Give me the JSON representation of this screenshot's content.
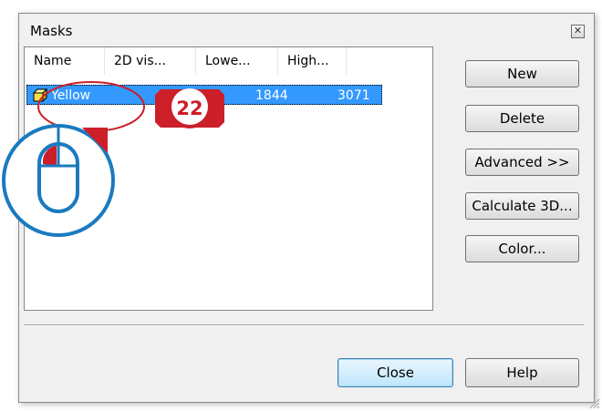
{
  "window": {
    "title": "Masks",
    "close_icon": "close-icon"
  },
  "list": {
    "columns": [
      "Name",
      "2D vis...",
      "Lowe...",
      "High..."
    ],
    "rows": [
      {
        "name": "Yellow",
        "lower": "1844",
        "higher": "3071",
        "icon": "yellow-cube-icon",
        "selected": true
      }
    ]
  },
  "buttons": {
    "new": "New",
    "delete": "Delete",
    "advanced": "Advanced >>",
    "calculate3d": "Calculate 3D...",
    "color": "Color...",
    "close": "Close",
    "help": "Help"
  },
  "annotation": {
    "step": "22",
    "icon": "mouse-click-icon",
    "accent": "#cc1f2a",
    "ring": "#1a7abf"
  },
  "colors": {
    "selection": "#3399ff",
    "dialog_bg": "#f0f0f0"
  }
}
